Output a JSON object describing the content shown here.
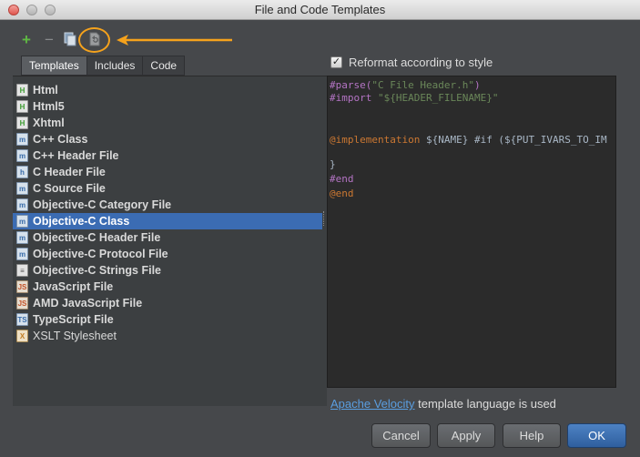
{
  "window": {
    "title": "File and Code Templates"
  },
  "toolbar": {
    "add_icon": "plus-icon",
    "remove_icon": "minus-icon",
    "copy_icon": "copy-template-icon",
    "reset_icon": "reset-to-default-icon",
    "annotation_color": "#f5a21c"
  },
  "tabs": [
    {
      "label": "Templates",
      "active": true
    },
    {
      "label": "Includes",
      "active": false
    },
    {
      "label": "Code",
      "active": false
    }
  ],
  "templates": [
    {
      "label": "Html",
      "icon": "html-file-icon",
      "badge": "H"
    },
    {
      "label": "Html5",
      "icon": "html-file-icon",
      "badge": "H"
    },
    {
      "label": "Xhtml",
      "icon": "html-file-icon",
      "badge": "H"
    },
    {
      "label": "C++ Class",
      "icon": "class-file-icon",
      "badge": "m"
    },
    {
      "label": "C++ Header File",
      "icon": "class-file-icon",
      "badge": "m"
    },
    {
      "label": "C Header File",
      "icon": "c-file-icon",
      "badge": "h"
    },
    {
      "label": "C Source File",
      "icon": "c-file-icon",
      "badge": "m"
    },
    {
      "label": "Objective-C Category File",
      "icon": "class-file-icon",
      "badge": "m"
    },
    {
      "label": "Objective-C Class",
      "icon": "class-file-icon",
      "badge": "m",
      "selected": true
    },
    {
      "label": "Objective-C Header File",
      "icon": "class-file-icon",
      "badge": "m"
    },
    {
      "label": "Objective-C Protocol File",
      "icon": "class-file-icon",
      "badge": "m"
    },
    {
      "label": "Objective-C Strings File",
      "icon": "text-file-icon",
      "badge": "≡"
    },
    {
      "label": "JavaScript File",
      "icon": "javascript-file-icon",
      "badge": "JS"
    },
    {
      "label": "AMD JavaScript File",
      "icon": "javascript-file-icon",
      "badge": "JS"
    },
    {
      "label": "TypeScript File",
      "icon": "typescript-file-icon",
      "badge": "TS"
    },
    {
      "label": "XSLT Stylesheet",
      "icon": "xslt-file-icon",
      "badge": "X"
    }
  ],
  "reformat": {
    "label": "Reformat according to style",
    "checked": true
  },
  "editor": {
    "line1_dir": "#parse(",
    "line1_str": "\"C File Header.h\"",
    "line1_end": ")",
    "line2_dir": "#import ",
    "line2_str": "\"${HEADER_FILENAME}\"",
    "line4_kw": "@implementation",
    "line4_rest": " ${NAME} #if (${PUT_IVARS_TO_IM",
    "line6": "}",
    "line7": "#end",
    "line8": "@end"
  },
  "footer": {
    "link": "Apache Velocity",
    "text": " template language is used"
  },
  "buttons": {
    "cancel": "Cancel",
    "apply": "Apply",
    "help": "Help",
    "ok": "OK"
  }
}
